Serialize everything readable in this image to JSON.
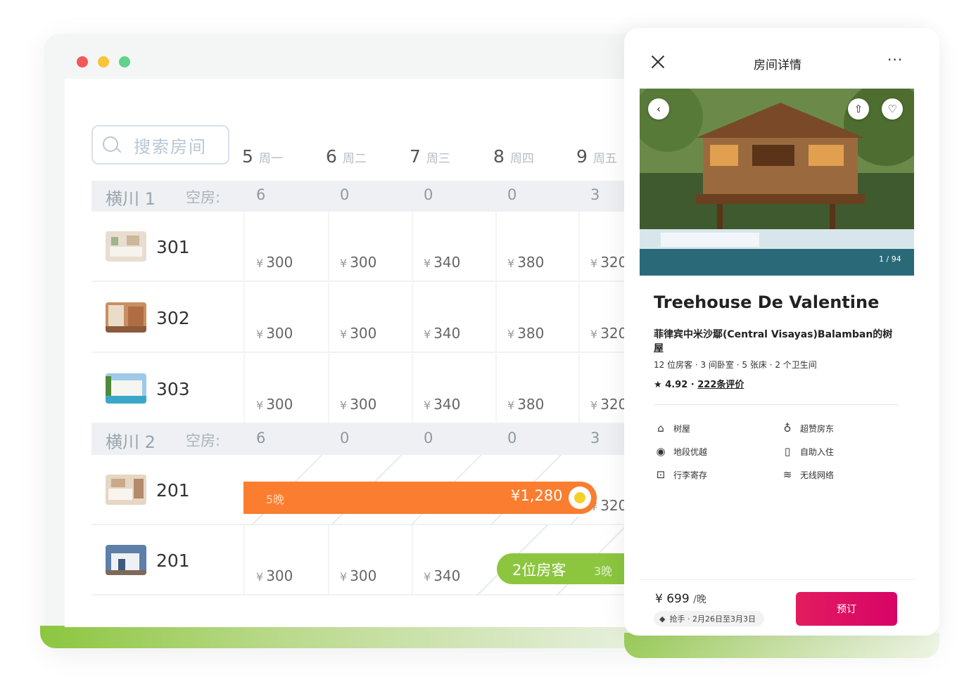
{
  "calendar": {
    "search_placeholder": "搜索房间",
    "days": [
      {
        "num": "5",
        "weekday": "周一"
      },
      {
        "num": "6",
        "weekday": "周二"
      },
      {
        "num": "7",
        "weekday": "周三"
      },
      {
        "num": "8",
        "weekday": "周四"
      },
      {
        "num": "9",
        "weekday": "周五"
      }
    ],
    "groups": [
      {
        "label": "横川 1",
        "vacancy_label": "空房:",
        "counts": [
          "6",
          "0",
          "0",
          "0",
          "3"
        ]
      },
      {
        "label": "横川 2",
        "vacancy_label": "空房:",
        "counts": [
          "6",
          "0",
          "0",
          "0",
          "3"
        ]
      }
    ],
    "rooms": [
      {
        "number": "301",
        "prices": [
          "300",
          "300",
          "340",
          "380",
          "320"
        ]
      },
      {
        "number": "302",
        "prices": [
          "300",
          "300",
          "340",
          "380",
          "320"
        ]
      },
      {
        "number": "303",
        "prices": [
          "300",
          "300",
          "340",
          "380",
          "320"
        ]
      },
      {
        "number": "201",
        "prices": [
          "320"
        ]
      },
      {
        "number": "201",
        "prices": [
          "300",
          "300",
          "340"
        ]
      }
    ],
    "currency": "¥",
    "booking_orange": {
      "nights": "5晚",
      "amount": "¥1,280",
      "color": "#fb7d2f"
    },
    "booking_green": {
      "guests": "2位房客",
      "nights": "3晚",
      "color": "#8cc63f"
    }
  },
  "details": {
    "title": "房间详情",
    "more": "···",
    "photo_counter": "1 / 94",
    "name": "Treehouse De Valentine",
    "location": "菲律宾中米沙鄢(Central Visayas)Balamban的树屋",
    "capacity": "12 位房客 · 3 间卧室 · 5 张床 · 2 个卫生间",
    "rating": "4.92",
    "reviews": "222条评价",
    "amenities": [
      {
        "icon": "treehouse-icon",
        "label": "树屋"
      },
      {
        "icon": "superhost-icon",
        "label": "超赞房东"
      },
      {
        "icon": "location-pin-icon",
        "label": "地段优越"
      },
      {
        "icon": "self-checkin-icon",
        "label": "自助入住"
      },
      {
        "icon": "luggage-icon",
        "label": "行李寄存"
      },
      {
        "icon": "wifi-icon",
        "label": "无线网络"
      }
    ],
    "price": "¥ 699",
    "price_unit": "/晚",
    "deal": "抢手 · 2月26日至3月3日",
    "reserve_label": "预订",
    "accent_color": "#e31c5f"
  }
}
